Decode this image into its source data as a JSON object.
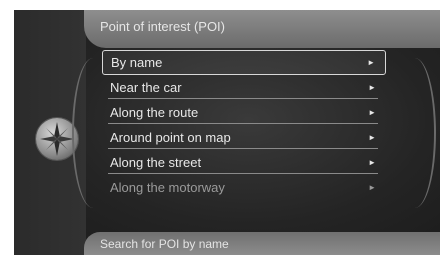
{
  "header": {
    "title": "Point of interest (POI)"
  },
  "menu": {
    "items": [
      {
        "label": "By name"
      },
      {
        "label": "Near the car"
      },
      {
        "label": "Along the route"
      },
      {
        "label": "Around point on map"
      },
      {
        "label": "Along the street"
      },
      {
        "label": "Along the motorway"
      }
    ],
    "arrow": "►"
  },
  "footer": {
    "text": "Search for POI by name"
  },
  "icons": {
    "compass": "compass-rose-icon"
  },
  "colors": {
    "background": "#242424",
    "header": "#7d7d7d",
    "text": "#e8e8e8",
    "dim_text": "#9a9a9a"
  }
}
